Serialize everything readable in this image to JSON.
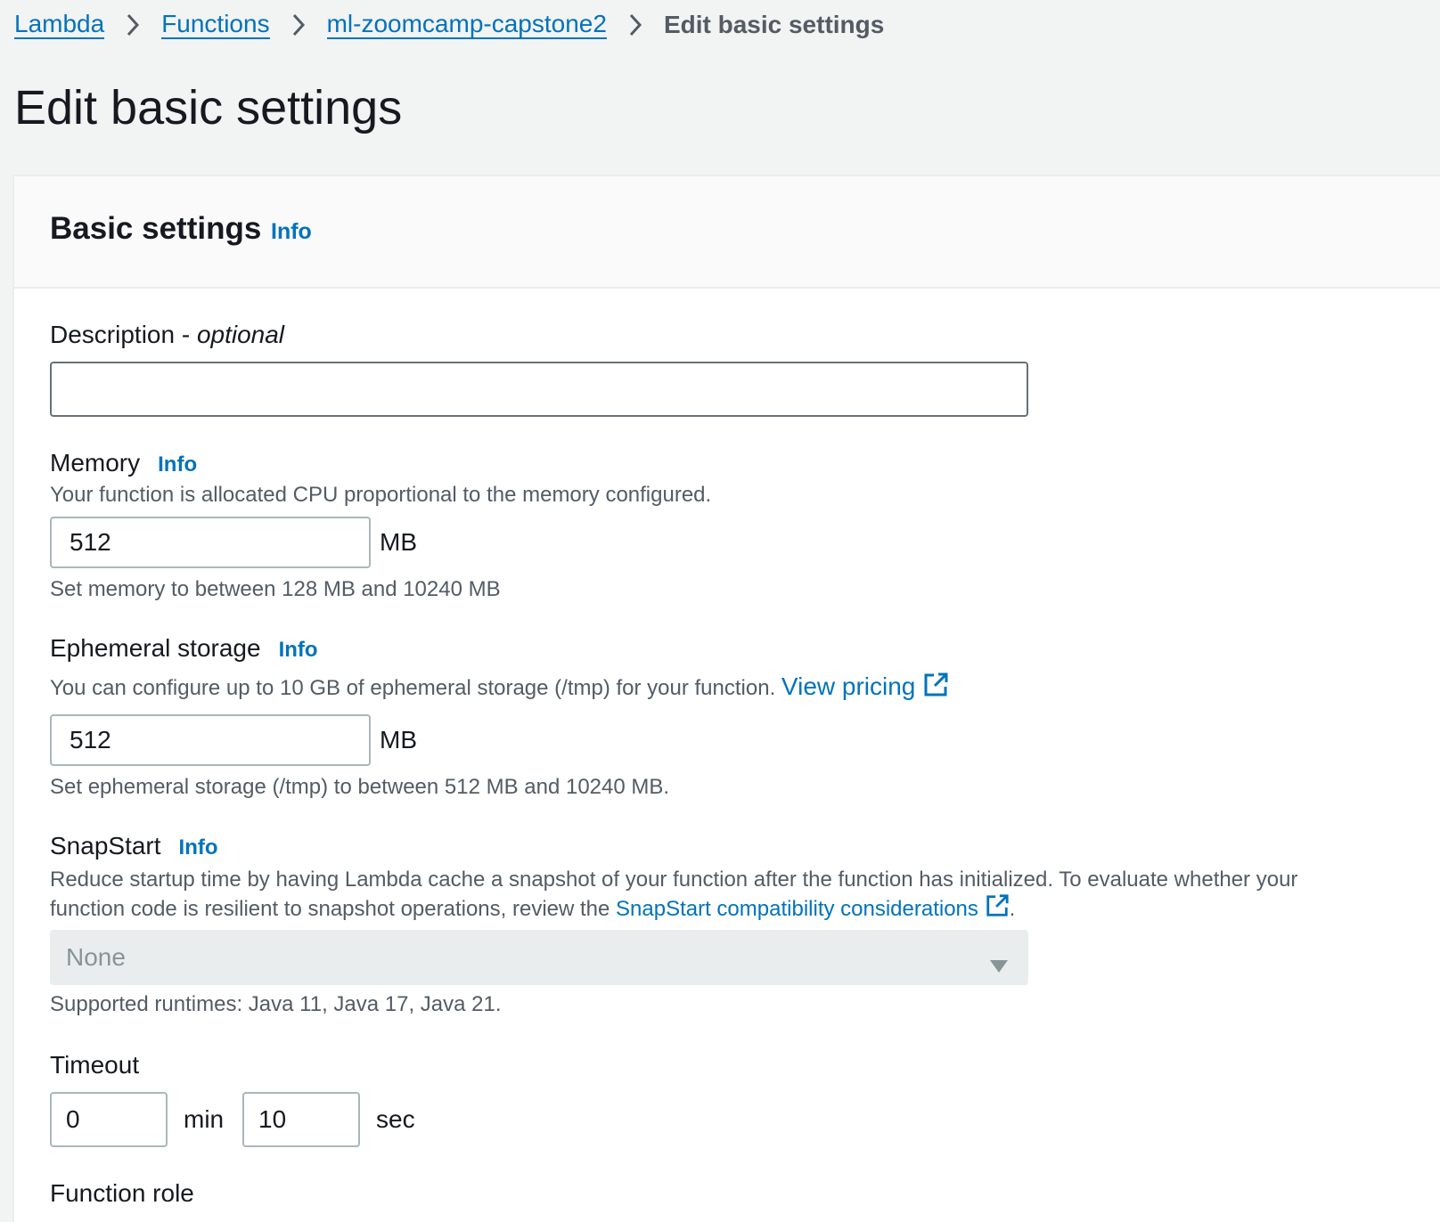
{
  "breadcrumbs": {
    "items": [
      "Lambda",
      "Functions",
      "ml-zoomcamp-capstone2"
    ],
    "current": "Edit basic settings"
  },
  "page": {
    "title": "Edit basic settings"
  },
  "panel": {
    "title": "Basic settings",
    "info_label": "Info"
  },
  "description": {
    "label": "Description - ",
    "label_optional": "optional",
    "value": ""
  },
  "memory": {
    "label": "Memory",
    "info_label": "Info",
    "description": "Your function is allocated CPU proportional to the memory configured.",
    "value": "512",
    "unit": "MB",
    "hint": "Set memory to between 128 MB and 10240 MB"
  },
  "ephemeral_storage": {
    "label": "Ephemeral storage",
    "info_label": "Info",
    "description": "You can configure up to 10 GB of ephemeral storage (/tmp) for your function.",
    "link_label": "View pricing",
    "value": "512",
    "unit": "MB",
    "hint": "Set ephemeral storage (/tmp) to between 512 MB and 10240 MB."
  },
  "snapstart": {
    "label": "SnapStart",
    "info_label": "Info",
    "description_line1": "Reduce startup time by having Lambda cache a snapshot of your function after the function has initialized. To evaluate whether your",
    "description_line2": "function code is resilient to snapshot operations, review the",
    "link_label": "SnapStart compatibility considerations",
    "link_suffix": ".",
    "selected": "None",
    "hint": "Supported runtimes: Java 11, Java 17, Java 21."
  },
  "timeout": {
    "label": "Timeout",
    "min_value": "0",
    "min_unit": "min",
    "sec_value": "10",
    "sec_unit": "sec"
  },
  "next_section": {
    "label": "Function role"
  },
  "colors": {
    "link": "#0073bb",
    "background": "#f2f3f3",
    "panel": "#ffffff",
    "text": "#16191f",
    "secondary_text": "#545b64"
  }
}
